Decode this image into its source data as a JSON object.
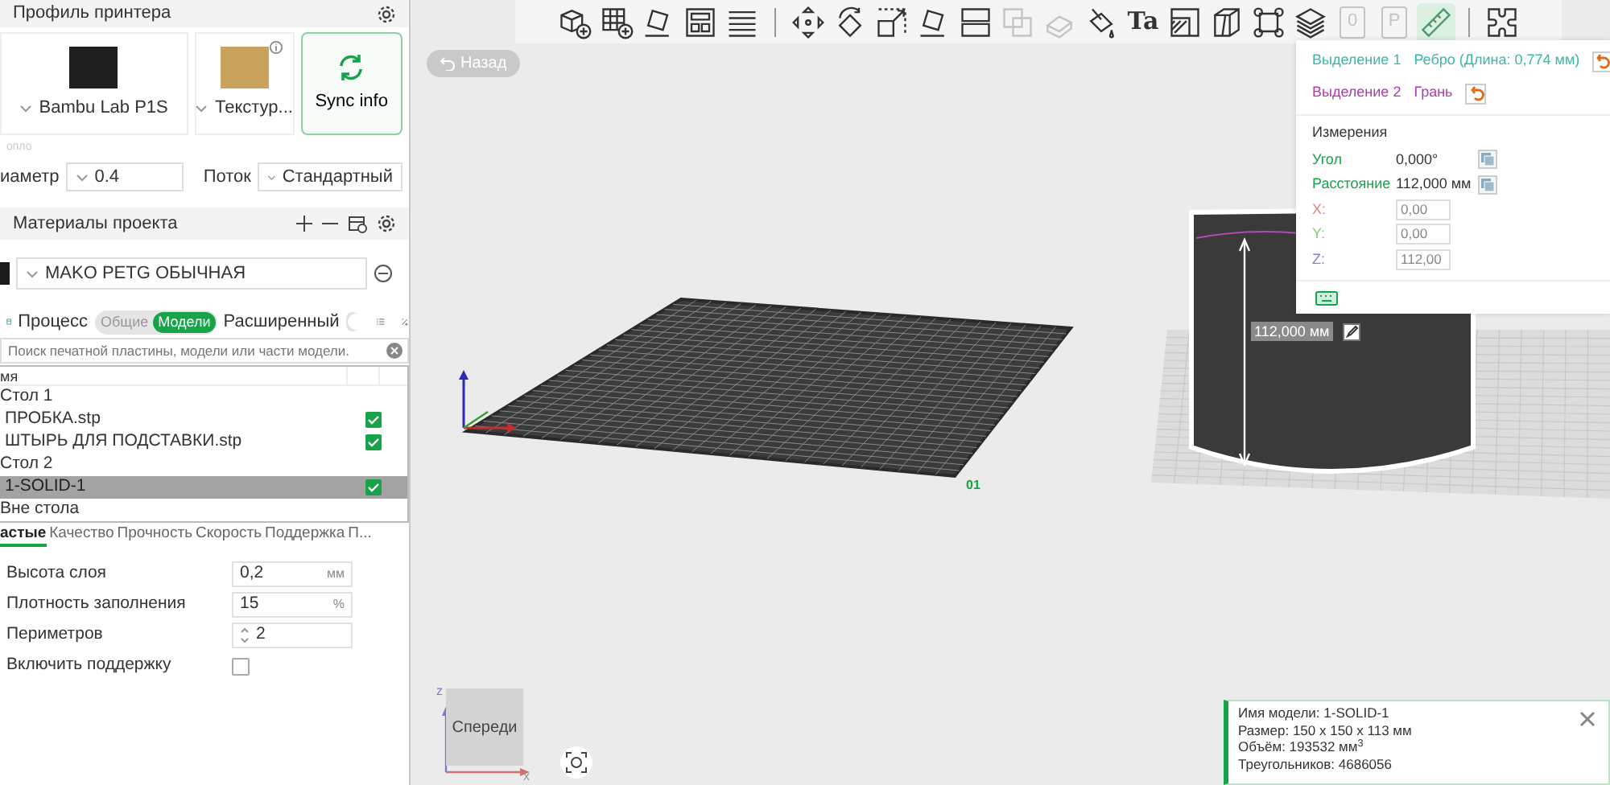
{
  "printer_section": {
    "title": "Профиль принтера",
    "printer": {
      "name": "Bambu Lab P1S"
    },
    "plate": {
      "name": "Текстур..."
    },
    "sync_button": "Sync info",
    "nozzle_label": "опло",
    "diameter": {
      "label": "иаметр",
      "value": "0.4"
    },
    "flow": {
      "label": "Поток",
      "value": "Стандартный"
    }
  },
  "materials_section": {
    "title": "Материалы проекта",
    "filaments": [
      {
        "name": "MAKO PETG ОБЫЧНАЯ",
        "color": "#1a1a1a"
      }
    ]
  },
  "process_section": {
    "title": "Процесс",
    "modes": [
      {
        "label": "Общие",
        "selected": false
      },
      {
        "label": "Модели",
        "selected": true
      }
    ],
    "advanced": {
      "label": "Расширенный",
      "on": false
    }
  },
  "search": {
    "placeholder": "Поиск печатной пластины, модели или части модели."
  },
  "object_tree": {
    "header": "мя",
    "items": [
      {
        "label": "Стол 1",
        "selected": false,
        "children": [
          {
            "label": "ПРОБКА.stp",
            "checked": true,
            "selected": false
          },
          {
            "label": "ШТЫРЬ ДЛЯ ПОДСТАВКИ.stp",
            "checked": true,
            "selected": false
          }
        ]
      },
      {
        "label": "Стол 2",
        "selected": false,
        "children": [
          {
            "label": "1-SOLID-1",
            "checked": true,
            "selected": true
          }
        ]
      },
      {
        "label": "Вне стола",
        "selected": false
      }
    ]
  },
  "settings_tabs": [
    {
      "label": "астые",
      "selected": true
    },
    {
      "label": "Качество",
      "selected": false
    },
    {
      "label": "Прочность",
      "selected": false
    },
    {
      "label": "Скорость",
      "selected": false
    },
    {
      "label": "Поддержка",
      "selected": false
    },
    {
      "label": "П...",
      "selected": false
    }
  ],
  "settings": [
    {
      "kind": "input",
      "label": "Высота слоя",
      "value": "0,2",
      "unit": "мм"
    },
    {
      "kind": "input",
      "label": "Плотность заполнения",
      "value": "15",
      "unit": "%"
    },
    {
      "kind": "spinner",
      "label": "Периметров",
      "value": "2"
    },
    {
      "kind": "checkbox",
      "label": "Включить поддержку",
      "checked": false
    }
  ],
  "toolbar_groups": [
    {
      "tools": [
        {
          "kind": "cube-plus",
          "disabled": false,
          "selected": false
        },
        {
          "kind": "grid-plus",
          "disabled": false,
          "selected": false
        },
        {
          "kind": "tilted-square",
          "disabled": false,
          "selected": false
        },
        {
          "kind": "layout-panels",
          "disabled": false,
          "selected": false
        },
        {
          "kind": "stacked-lines",
          "disabled": false,
          "selected": false
        }
      ]
    },
    {
      "tools": [
        {
          "kind": "move-arrows",
          "disabled": false,
          "selected": false
        },
        {
          "kind": "rotate-arrow",
          "disabled": false,
          "selected": false
        },
        {
          "kind": "scale-square",
          "disabled": false,
          "selected": false
        },
        {
          "kind": "tilted-square",
          "disabled": false,
          "selected": false
        },
        {
          "kind": "split-rects",
          "disabled": false,
          "selected": false
        },
        {
          "kind": "overlap-squares",
          "disabled": true,
          "selected": false
        },
        {
          "kind": "slanted-block",
          "disabled": true,
          "selected": false
        },
        {
          "kind": "paint-bucket",
          "disabled": false,
          "selected": false
        },
        {
          "kind": "letters",
          "label": "Ta",
          "disabled": false,
          "selected": false
        },
        {
          "kind": "hatched-square",
          "disabled": false,
          "selected": false
        },
        {
          "kind": "cube-cut",
          "disabled": false,
          "selected": false
        },
        {
          "kind": "corner-square",
          "disabled": false,
          "selected": false
        },
        {
          "kind": "layered-stack",
          "disabled": false,
          "selected": false
        },
        {
          "kind": "page-letter",
          "label": "0",
          "disabled": true,
          "selected": false
        },
        {
          "kind": "page-letter",
          "label": "P",
          "disabled": true,
          "selected": false
        },
        {
          "kind": "ruler",
          "disabled": false,
          "selected": true
        }
      ]
    },
    {
      "tools": [
        {
          "kind": "puzzle",
          "disabled": false,
          "selected": false
        }
      ]
    }
  ],
  "back_button": {
    "label": "Назад",
    "disabled": true
  },
  "measure_panel": {
    "selections": [
      {
        "label": "Выделение 1",
        "value": "Ребро (Длина: 0,774 мм)",
        "color": "#3cb7a6"
      },
      {
        "label": "Выделение 2",
        "value": "Грань",
        "color": "#b03ab0"
      }
    ],
    "title": "Измерения",
    "results": [
      {
        "label": "Угол",
        "value": "0,000°"
      },
      {
        "label": "Расстояние",
        "value": "112,000 мм"
      }
    ],
    "coordinates": [
      {
        "label": "X:",
        "value": "0,00",
        "color": "#e08585"
      },
      {
        "label": "Y:",
        "value": "0,00",
        "color": "#8ccc74"
      },
      {
        "label": "Z:",
        "value": "112,00",
        "color": "#7f7fd8"
      }
    ]
  },
  "dimension_label": "112,000 мм",
  "bed_label": "01",
  "view_cube": {
    "face": "Спереди",
    "axes": [
      "z",
      "x"
    ]
  },
  "model_info": {
    "lines": [
      "Имя модели: 1-SOLID-1",
      "Размер: 150 x 150 x 113 мм",
      "Объём: 193532 мм$^{3}$",
      "Треугольников: 4686056"
    ]
  }
}
